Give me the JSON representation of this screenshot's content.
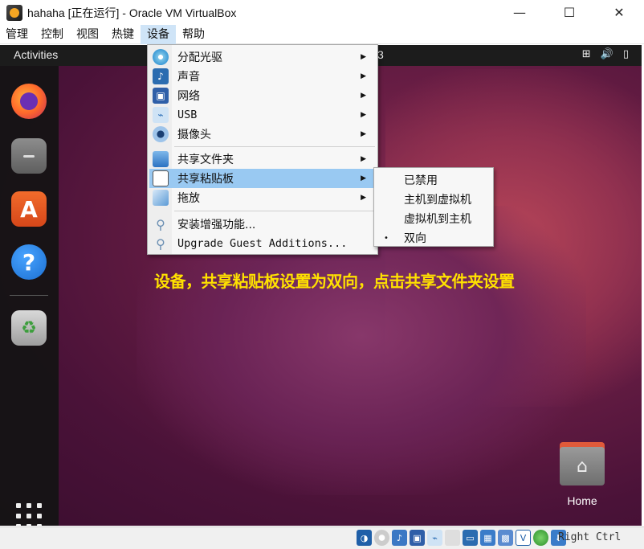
{
  "window": {
    "title": "hahaha [正在运行] - Oracle VM VirtualBox",
    "minimize": "—",
    "maximize": "☐",
    "close": "✕"
  },
  "menubar": [
    "管理",
    "控制",
    "视图",
    "热键",
    "设备",
    "帮助"
  ],
  "guest": {
    "activities": "Activities",
    "clock_fragment": "3",
    "home_label": "Home",
    "help_glyph": "?",
    "trash_glyph": "♻"
  },
  "devices_menu": {
    "items": [
      {
        "label": "分配光驱",
        "icon": "optical-disc-icon",
        "has_submenu": true
      },
      {
        "label": "声音",
        "icon": "audio-icon",
        "has_submenu": true
      },
      {
        "label": "网络",
        "icon": "network-icon",
        "has_submenu": true
      },
      {
        "label": "USB",
        "icon": "usb-icon",
        "has_submenu": true
      },
      {
        "label": "摄像头",
        "icon": "webcam-icon",
        "has_submenu": true
      },
      {
        "label": "共享文件夹",
        "icon": "shared-folder-icon",
        "has_submenu": true
      },
      {
        "label": "共享粘贴板",
        "icon": "clipboard-icon",
        "has_submenu": true,
        "highlighted": true
      },
      {
        "label": "拖放",
        "icon": "drag-drop-icon",
        "has_submenu": true
      },
      {
        "label": "安装增强功能...",
        "icon": "guest-additions-icon",
        "has_submenu": false
      },
      {
        "label": "Upgrade Guest Additions...",
        "icon": "upgrade-additions-icon",
        "has_submenu": false
      }
    ]
  },
  "clipboard_submenu": {
    "items": [
      {
        "label": "已禁用",
        "checked": false
      },
      {
        "label": "主机到虚拟机",
        "checked": false
      },
      {
        "label": "虚拟机到主机",
        "checked": false
      },
      {
        "label": "双向",
        "checked": true
      }
    ],
    "bullet": "•"
  },
  "annotation": "设备，共享粘贴板设置为双向，点击共享文件夹设置",
  "statusbar": {
    "host_key": "Right Ctrl"
  },
  "colors": {
    "highlight": "#99c9f2",
    "annotation": "#ffe100",
    "menu_bg": "#f7f7f7"
  }
}
